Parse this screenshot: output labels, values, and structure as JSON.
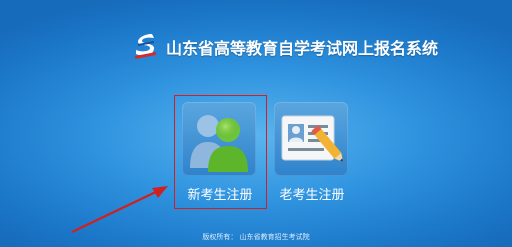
{
  "header": {
    "logo_icon": "province-logo-icon",
    "title": "山东省高等教育自学考试网上报名系统"
  },
  "tiles": [
    {
      "label": "新考生注册",
      "icon": "users-icon"
    },
    {
      "label": "老考生注册",
      "icon": "id-card-pencil-icon"
    }
  ],
  "footer": {
    "copyright": "版权所有：  山东省教育招生考试院"
  },
  "colors": {
    "background": "#2f93df",
    "highlight": "#d02020",
    "text": "#ffffff"
  }
}
